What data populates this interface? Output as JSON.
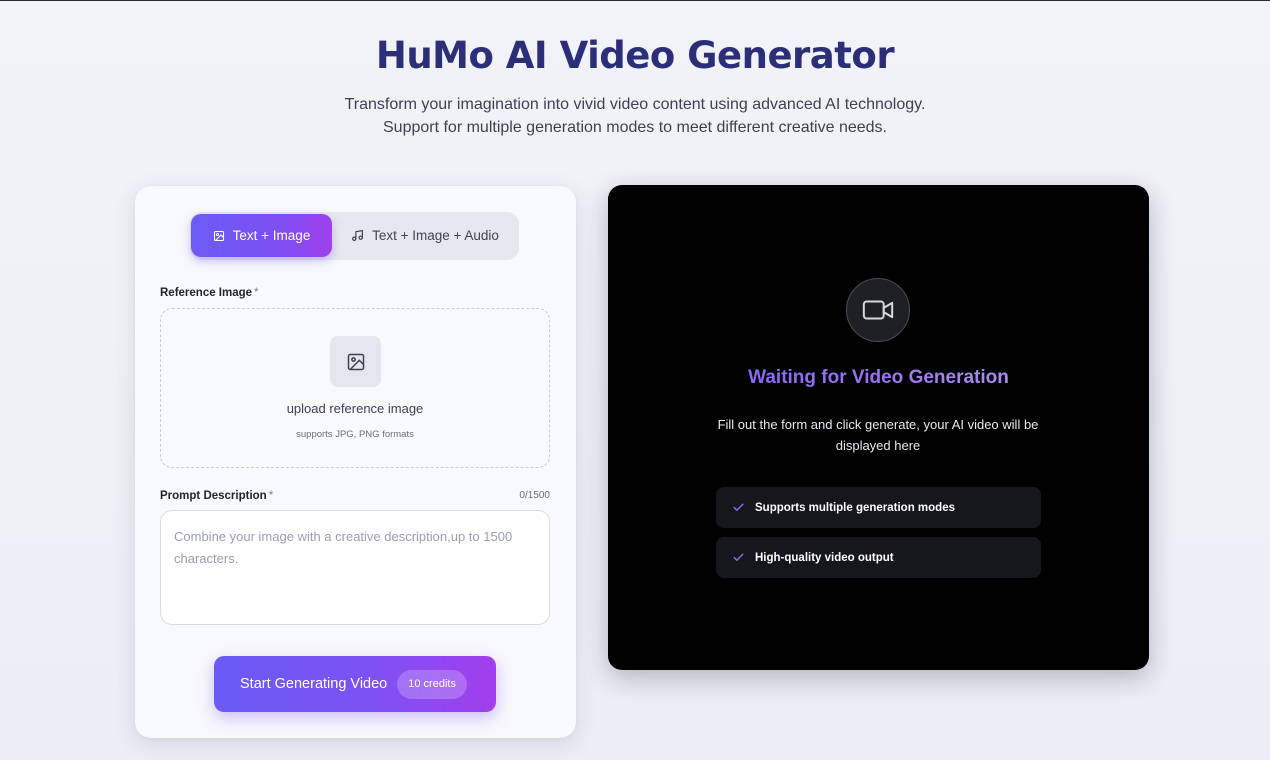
{
  "header": {
    "title": "HuMo AI Video Generator",
    "subtitle_line1": "Transform your imagination into vivid video content using advanced AI technology.",
    "subtitle_line2": "Support for multiple generation modes to meet different creative needs."
  },
  "form": {
    "tabs": [
      {
        "label": "Text + Image",
        "icon": "image-icon",
        "active": true
      },
      {
        "label": "Text + Image + Audio",
        "icon": "music-note-icon",
        "active": false
      }
    ],
    "reference_image": {
      "label": "Reference Image",
      "required_mark": "*",
      "upload_title": "upload reference image",
      "upload_hint": "supports JPG, PNG formats"
    },
    "prompt": {
      "label": "Prompt Description",
      "required_mark": "*",
      "counter": "0/1500",
      "placeholder": "Combine your image with a creative description,up to 1500 characters.",
      "value": ""
    },
    "generate": {
      "label": "Start Generating Video",
      "credits": "10 credits"
    }
  },
  "preview": {
    "icon": "video-camera-icon",
    "title": "Waiting for Video Generation",
    "description": "Fill out the form and click generate, your AI video will be displayed here",
    "features": [
      "Supports multiple generation modes",
      "High-quality video output"
    ]
  },
  "colors": {
    "accent": "#7b4ff2",
    "title": "#2c2f78",
    "panel_bg": "#000000"
  }
}
